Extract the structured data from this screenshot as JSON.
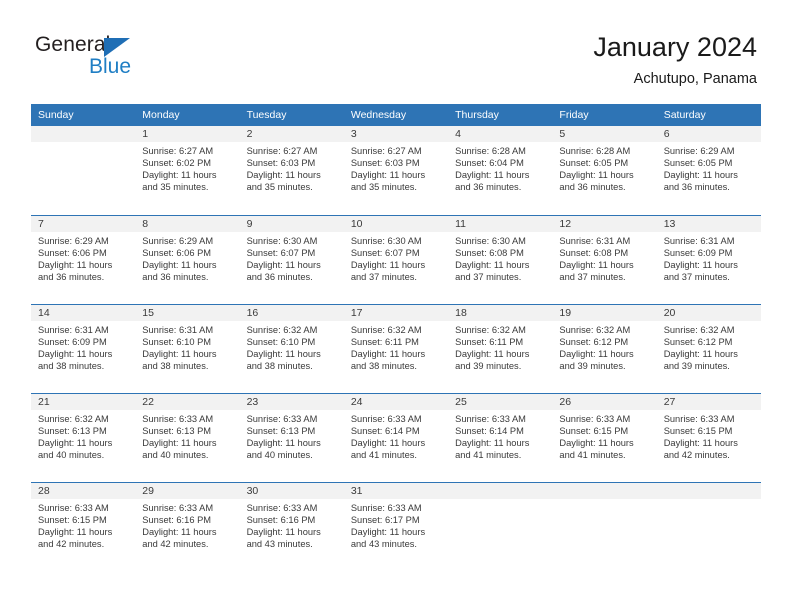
{
  "brand": {
    "name_top": "General",
    "name_bottom": "Blue",
    "triangle_color": "#1f6eb5",
    "blue_text_color": "#1f7ec4"
  },
  "header": {
    "title": "January 2024",
    "subtitle": "Achutupo, Panama"
  },
  "theme": {
    "header_blue": "#2e74b5",
    "daynum_band": "#f2f2f2",
    "text": "#3a3a3a"
  },
  "calendar": {
    "weekday_headers": [
      "Sunday",
      "Monday",
      "Tuesday",
      "Wednesday",
      "Thursday",
      "Friday",
      "Saturday"
    ],
    "weeks": [
      [
        {
          "day": "",
          "sunrise": "",
          "sunset": "",
          "daylight_line1": "",
          "daylight_line2": ""
        },
        {
          "day": "1",
          "sunrise": "Sunrise: 6:27 AM",
          "sunset": "Sunset: 6:02 PM",
          "daylight_line1": "Daylight: 11 hours",
          "daylight_line2": "and 35 minutes."
        },
        {
          "day": "2",
          "sunrise": "Sunrise: 6:27 AM",
          "sunset": "Sunset: 6:03 PM",
          "daylight_line1": "Daylight: 11 hours",
          "daylight_line2": "and 35 minutes."
        },
        {
          "day": "3",
          "sunrise": "Sunrise: 6:27 AM",
          "sunset": "Sunset: 6:03 PM",
          "daylight_line1": "Daylight: 11 hours",
          "daylight_line2": "and 35 minutes."
        },
        {
          "day": "4",
          "sunrise": "Sunrise: 6:28 AM",
          "sunset": "Sunset: 6:04 PM",
          "daylight_line1": "Daylight: 11 hours",
          "daylight_line2": "and 36 minutes."
        },
        {
          "day": "5",
          "sunrise": "Sunrise: 6:28 AM",
          "sunset": "Sunset: 6:05 PM",
          "daylight_line1": "Daylight: 11 hours",
          "daylight_line2": "and 36 minutes."
        },
        {
          "day": "6",
          "sunrise": "Sunrise: 6:29 AM",
          "sunset": "Sunset: 6:05 PM",
          "daylight_line1": "Daylight: 11 hours",
          "daylight_line2": "and 36 minutes."
        }
      ],
      [
        {
          "day": "7",
          "sunrise": "Sunrise: 6:29 AM",
          "sunset": "Sunset: 6:06 PM",
          "daylight_line1": "Daylight: 11 hours",
          "daylight_line2": "and 36 minutes."
        },
        {
          "day": "8",
          "sunrise": "Sunrise: 6:29 AM",
          "sunset": "Sunset: 6:06 PM",
          "daylight_line1": "Daylight: 11 hours",
          "daylight_line2": "and 36 minutes."
        },
        {
          "day": "9",
          "sunrise": "Sunrise: 6:30 AM",
          "sunset": "Sunset: 6:07 PM",
          "daylight_line1": "Daylight: 11 hours",
          "daylight_line2": "and 36 minutes."
        },
        {
          "day": "10",
          "sunrise": "Sunrise: 6:30 AM",
          "sunset": "Sunset: 6:07 PM",
          "daylight_line1": "Daylight: 11 hours",
          "daylight_line2": "and 37 minutes."
        },
        {
          "day": "11",
          "sunrise": "Sunrise: 6:30 AM",
          "sunset": "Sunset: 6:08 PM",
          "daylight_line1": "Daylight: 11 hours",
          "daylight_line2": "and 37 minutes."
        },
        {
          "day": "12",
          "sunrise": "Sunrise: 6:31 AM",
          "sunset": "Sunset: 6:08 PM",
          "daylight_line1": "Daylight: 11 hours",
          "daylight_line2": "and 37 minutes."
        },
        {
          "day": "13",
          "sunrise": "Sunrise: 6:31 AM",
          "sunset": "Sunset: 6:09 PM",
          "daylight_line1": "Daylight: 11 hours",
          "daylight_line2": "and 37 minutes."
        }
      ],
      [
        {
          "day": "14",
          "sunrise": "Sunrise: 6:31 AM",
          "sunset": "Sunset: 6:09 PM",
          "daylight_line1": "Daylight: 11 hours",
          "daylight_line2": "and 38 minutes."
        },
        {
          "day": "15",
          "sunrise": "Sunrise: 6:31 AM",
          "sunset": "Sunset: 6:10 PM",
          "daylight_line1": "Daylight: 11 hours",
          "daylight_line2": "and 38 minutes."
        },
        {
          "day": "16",
          "sunrise": "Sunrise: 6:32 AM",
          "sunset": "Sunset: 6:10 PM",
          "daylight_line1": "Daylight: 11 hours",
          "daylight_line2": "and 38 minutes."
        },
        {
          "day": "17",
          "sunrise": "Sunrise: 6:32 AM",
          "sunset": "Sunset: 6:11 PM",
          "daylight_line1": "Daylight: 11 hours",
          "daylight_line2": "and 38 minutes."
        },
        {
          "day": "18",
          "sunrise": "Sunrise: 6:32 AM",
          "sunset": "Sunset: 6:11 PM",
          "daylight_line1": "Daylight: 11 hours",
          "daylight_line2": "and 39 minutes."
        },
        {
          "day": "19",
          "sunrise": "Sunrise: 6:32 AM",
          "sunset": "Sunset: 6:12 PM",
          "daylight_line1": "Daylight: 11 hours",
          "daylight_line2": "and 39 minutes."
        },
        {
          "day": "20",
          "sunrise": "Sunrise: 6:32 AM",
          "sunset": "Sunset: 6:12 PM",
          "daylight_line1": "Daylight: 11 hours",
          "daylight_line2": "and 39 minutes."
        }
      ],
      [
        {
          "day": "21",
          "sunrise": "Sunrise: 6:32 AM",
          "sunset": "Sunset: 6:13 PM",
          "daylight_line1": "Daylight: 11 hours",
          "daylight_line2": "and 40 minutes."
        },
        {
          "day": "22",
          "sunrise": "Sunrise: 6:33 AM",
          "sunset": "Sunset: 6:13 PM",
          "daylight_line1": "Daylight: 11 hours",
          "daylight_line2": "and 40 minutes."
        },
        {
          "day": "23",
          "sunrise": "Sunrise: 6:33 AM",
          "sunset": "Sunset: 6:13 PM",
          "daylight_line1": "Daylight: 11 hours",
          "daylight_line2": "and 40 minutes."
        },
        {
          "day": "24",
          "sunrise": "Sunrise: 6:33 AM",
          "sunset": "Sunset: 6:14 PM",
          "daylight_line1": "Daylight: 11 hours",
          "daylight_line2": "and 41 minutes."
        },
        {
          "day": "25",
          "sunrise": "Sunrise: 6:33 AM",
          "sunset": "Sunset: 6:14 PM",
          "daylight_line1": "Daylight: 11 hours",
          "daylight_line2": "and 41 minutes."
        },
        {
          "day": "26",
          "sunrise": "Sunrise: 6:33 AM",
          "sunset": "Sunset: 6:15 PM",
          "daylight_line1": "Daylight: 11 hours",
          "daylight_line2": "and 41 minutes."
        },
        {
          "day": "27",
          "sunrise": "Sunrise: 6:33 AM",
          "sunset": "Sunset: 6:15 PM",
          "daylight_line1": "Daylight: 11 hours",
          "daylight_line2": "and 42 minutes."
        }
      ],
      [
        {
          "day": "28",
          "sunrise": "Sunrise: 6:33 AM",
          "sunset": "Sunset: 6:15 PM",
          "daylight_line1": "Daylight: 11 hours",
          "daylight_line2": "and 42 minutes."
        },
        {
          "day": "29",
          "sunrise": "Sunrise: 6:33 AM",
          "sunset": "Sunset: 6:16 PM",
          "daylight_line1": "Daylight: 11 hours",
          "daylight_line2": "and 42 minutes."
        },
        {
          "day": "30",
          "sunrise": "Sunrise: 6:33 AM",
          "sunset": "Sunset: 6:16 PM",
          "daylight_line1": "Daylight: 11 hours",
          "daylight_line2": "and 43 minutes."
        },
        {
          "day": "31",
          "sunrise": "Sunrise: 6:33 AM",
          "sunset": "Sunset: 6:17 PM",
          "daylight_line1": "Daylight: 11 hours",
          "daylight_line2": "and 43 minutes."
        },
        {
          "day": "",
          "sunrise": "",
          "sunset": "",
          "daylight_line1": "",
          "daylight_line2": ""
        },
        {
          "day": "",
          "sunrise": "",
          "sunset": "",
          "daylight_line1": "",
          "daylight_line2": ""
        },
        {
          "day": "",
          "sunrise": "",
          "sunset": "",
          "daylight_line1": "",
          "daylight_line2": ""
        }
      ]
    ]
  }
}
